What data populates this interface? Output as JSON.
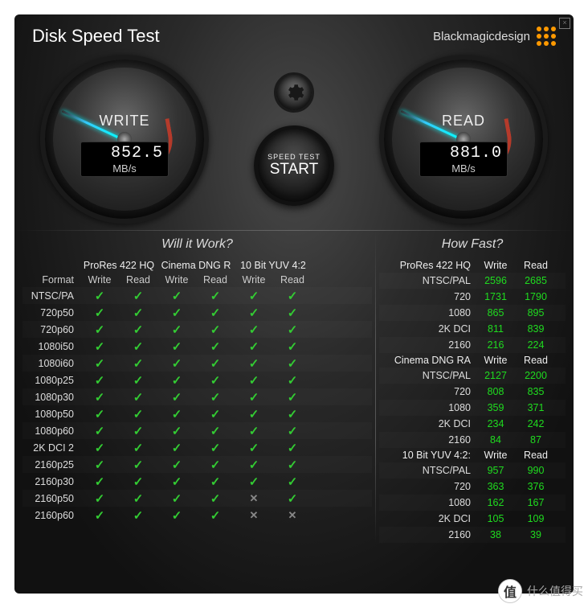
{
  "header": {
    "title": "Disk Speed Test",
    "brand": "Blackmagicdesign"
  },
  "gauges": {
    "write": {
      "label": "WRITE",
      "value": "852.5",
      "unit": "MB/s",
      "needle_deg": 205
    },
    "read": {
      "label": "READ",
      "value": "881.0",
      "unit": "MB/s",
      "needle_deg": 205
    }
  },
  "start_button": {
    "top": "SPEED TEST",
    "main": "START"
  },
  "sections": {
    "work": "Will it Work?",
    "fast": "How Fast?"
  },
  "work": {
    "groups": [
      "ProRes 422 HQ",
      "Cinema DNG R",
      "10 Bit YUV 4:2"
    ],
    "sub": [
      "Write",
      "Read",
      "Write",
      "Read",
      "Write",
      "Read"
    ],
    "format_header": "Format",
    "rows": [
      {
        "fmt": "NTSC/PA",
        "cells": [
          1,
          1,
          1,
          1,
          1,
          1
        ]
      },
      {
        "fmt": "720p50",
        "cells": [
          1,
          1,
          1,
          1,
          1,
          1
        ]
      },
      {
        "fmt": "720p60",
        "cells": [
          1,
          1,
          1,
          1,
          1,
          1
        ]
      },
      {
        "fmt": "1080i50",
        "cells": [
          1,
          1,
          1,
          1,
          1,
          1
        ]
      },
      {
        "fmt": "1080i60",
        "cells": [
          1,
          1,
          1,
          1,
          1,
          1
        ]
      },
      {
        "fmt": "1080p25",
        "cells": [
          1,
          1,
          1,
          1,
          1,
          1
        ]
      },
      {
        "fmt": "1080p30",
        "cells": [
          1,
          1,
          1,
          1,
          1,
          1
        ]
      },
      {
        "fmt": "1080p50",
        "cells": [
          1,
          1,
          1,
          1,
          1,
          1
        ]
      },
      {
        "fmt": "1080p60",
        "cells": [
          1,
          1,
          1,
          1,
          1,
          1
        ]
      },
      {
        "fmt": "2K DCI 2",
        "cells": [
          1,
          1,
          1,
          1,
          1,
          1
        ]
      },
      {
        "fmt": "2160p25",
        "cells": [
          1,
          1,
          1,
          1,
          1,
          1
        ]
      },
      {
        "fmt": "2160p30",
        "cells": [
          1,
          1,
          1,
          1,
          1,
          1
        ]
      },
      {
        "fmt": "2160p50",
        "cells": [
          1,
          1,
          1,
          1,
          0,
          1
        ]
      },
      {
        "fmt": "2160p60",
        "cells": [
          1,
          1,
          1,
          1,
          0,
          0
        ]
      }
    ]
  },
  "fast": {
    "col_write": "Write",
    "col_read": "Read",
    "groups": [
      {
        "name": "ProRes 422 HQ",
        "rows": [
          {
            "lbl": "NTSC/PAL",
            "w": "2596",
            "r": "2685"
          },
          {
            "lbl": "720",
            "w": "1731",
            "r": "1790"
          },
          {
            "lbl": "1080",
            "w": "865",
            "r": "895"
          },
          {
            "lbl": "2K DCI",
            "w": "811",
            "r": "839"
          },
          {
            "lbl": "2160",
            "w": "216",
            "r": "224"
          }
        ]
      },
      {
        "name": "Cinema DNG RA",
        "rows": [
          {
            "lbl": "NTSC/PAL",
            "w": "2127",
            "r": "2200"
          },
          {
            "lbl": "720",
            "w": "808",
            "r": "835"
          },
          {
            "lbl": "1080",
            "w": "359",
            "r": "371"
          },
          {
            "lbl": "2K DCI",
            "w": "234",
            "r": "242"
          },
          {
            "lbl": "2160",
            "w": "84",
            "r": "87"
          }
        ]
      },
      {
        "name": "10 Bit YUV 4:2:",
        "rows": [
          {
            "lbl": "NTSC/PAL",
            "w": "957",
            "r": "990"
          },
          {
            "lbl": "720",
            "w": "363",
            "r": "376"
          },
          {
            "lbl": "1080",
            "w": "162",
            "r": "167"
          },
          {
            "lbl": "2K DCI",
            "w": "105",
            "r": "109"
          },
          {
            "lbl": "2160",
            "w": "38",
            "r": "39"
          }
        ]
      }
    ]
  },
  "watermark": "什么值得买"
}
